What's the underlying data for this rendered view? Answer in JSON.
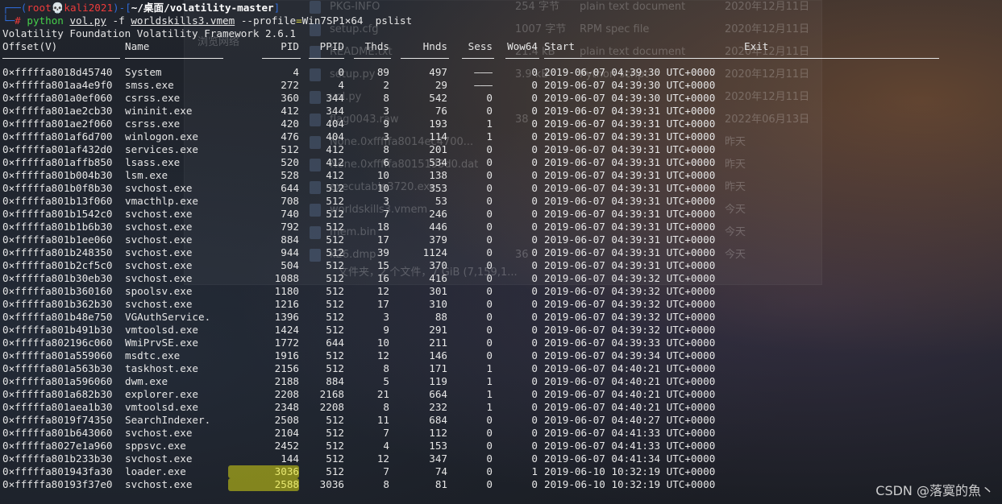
{
  "prompt": {
    "user": "root",
    "skull": "💀",
    "host": "kali2021",
    "path": "~/桌面/volatility-master",
    "hash": "#",
    "cmd_program": "python",
    "cmd_script": "vol.py",
    "cmd_flag_f": "-f",
    "cmd_image": "worldskills3.vmem",
    "cmd_profile_flag": "--profile",
    "cmd_profile_value": "Win7SP1×64",
    "cmd_plugin": "pslist"
  },
  "banner": "Volatility Foundation Volatility Framework 2.6.1",
  "table": {
    "headers": [
      "Offset(V)",
      "Name",
      "PID",
      "PPID",
      "Thds",
      "Hnds",
      "Sess",
      "Wow64",
      "Start",
      "Exit"
    ],
    "rows": [
      [
        "0×fffffa8018d45740",
        "System",
        "4",
        "0",
        "89",
        "497",
        "———",
        "0",
        "2019-06-07 04:39:30 UTC+0000"
      ],
      [
        "0×fffffa801aa4e9f0",
        "smss.exe",
        "272",
        "4",
        "2",
        "29",
        "———",
        "0",
        "2019-06-07 04:39:30 UTC+0000"
      ],
      [
        "0×fffffa801a0ef060",
        "csrss.exe",
        "360",
        "344",
        "8",
        "542",
        "0",
        "0",
        "2019-06-07 04:39:30 UTC+0000"
      ],
      [
        "0×fffffa801ae2cb30",
        "wininit.exe",
        "412",
        "344",
        "3",
        "76",
        "0",
        "0",
        "2019-06-07 04:39:31 UTC+0000"
      ],
      [
        "0×fffffa801ae2f060",
        "csrss.exe",
        "420",
        "404",
        "9",
        "193",
        "1",
        "0",
        "2019-06-07 04:39:31 UTC+0000"
      ],
      [
        "0×fffffa801af6d700",
        "winlogon.exe",
        "476",
        "404",
        "3",
        "114",
        "1",
        "0",
        "2019-06-07 04:39:31 UTC+0000"
      ],
      [
        "0×fffffa801af432d0",
        "services.exe",
        "512",
        "412",
        "8",
        "201",
        "0",
        "0",
        "2019-06-07 04:39:31 UTC+0000"
      ],
      [
        "0×fffffa801affb850",
        "lsass.exe",
        "520",
        "412",
        "6",
        "534",
        "0",
        "0",
        "2019-06-07 04:39:31 UTC+0000"
      ],
      [
        "0×fffffa801b004b30",
        "lsm.exe",
        "528",
        "412",
        "10",
        "138",
        "0",
        "0",
        "2019-06-07 04:39:31 UTC+0000"
      ],
      [
        "0×fffffa801b0f8b30",
        "svchost.exe",
        "644",
        "512",
        "10",
        "353",
        "0",
        "0",
        "2019-06-07 04:39:31 UTC+0000"
      ],
      [
        "0×fffffa801b13f060",
        "vmacthlp.exe",
        "708",
        "512",
        "3",
        "53",
        "0",
        "0",
        "2019-06-07 04:39:31 UTC+0000"
      ],
      [
        "0×fffffa801b1542c0",
        "svchost.exe",
        "740",
        "512",
        "7",
        "246",
        "0",
        "0",
        "2019-06-07 04:39:31 UTC+0000"
      ],
      [
        "0×fffffa801b1b6b30",
        "svchost.exe",
        "792",
        "512",
        "18",
        "446",
        "0",
        "0",
        "2019-06-07 04:39:31 UTC+0000"
      ],
      [
        "0×fffffa801b1ee060",
        "svchost.exe",
        "884",
        "512",
        "17",
        "379",
        "0",
        "0",
        "2019-06-07 04:39:31 UTC+0000"
      ],
      [
        "0×fffffa801b248350",
        "svchost.exe",
        "944",
        "512",
        "39",
        "1124",
        "0",
        "0",
        "2019-06-07 04:39:31 UTC+0000"
      ],
      [
        "0×fffffa801b2cf5c0",
        "svchost.exe",
        "504",
        "512",
        "15",
        "370",
        "0",
        "0",
        "2019-06-07 04:39:31 UTC+0000"
      ],
      [
        "0×fffffa801b30eb30",
        "svchost.exe",
        "1088",
        "512",
        "16",
        "416",
        "0",
        "0",
        "2019-06-07 04:39:32 UTC+0000"
      ],
      [
        "0×fffffa801b360160",
        "spoolsv.exe",
        "1180",
        "512",
        "12",
        "301",
        "0",
        "0",
        "2019-06-07 04:39:32 UTC+0000"
      ],
      [
        "0×fffffa801b362b30",
        "svchost.exe",
        "1216",
        "512",
        "17",
        "310",
        "0",
        "0",
        "2019-06-07 04:39:32 UTC+0000"
      ],
      [
        "0×fffffa801b48e750",
        "VGAuthService.",
        "1396",
        "512",
        "3",
        "88",
        "0",
        "0",
        "2019-06-07 04:39:32 UTC+0000"
      ],
      [
        "0×fffffa801b491b30",
        "vmtoolsd.exe",
        "1424",
        "512",
        "9",
        "291",
        "0",
        "0",
        "2019-06-07 04:39:32 UTC+0000"
      ],
      [
        "0×fffffa802196c060",
        "WmiPrvSE.exe",
        "1772",
        "644",
        "10",
        "211",
        "0",
        "0",
        "2019-06-07 04:39:33 UTC+0000"
      ],
      [
        "0×fffffa801a559060",
        "msdtc.exe",
        "1916",
        "512",
        "12",
        "146",
        "0",
        "0",
        "2019-06-07 04:39:34 UTC+0000"
      ],
      [
        "0×fffffa801a563b30",
        "taskhost.exe",
        "2156",
        "512",
        "8",
        "171",
        "1",
        "0",
        "2019-06-07 04:40:21 UTC+0000"
      ],
      [
        "0×fffffa801a596060",
        "dwm.exe",
        "2188",
        "884",
        "5",
        "119",
        "1",
        "0",
        "2019-06-07 04:40:21 UTC+0000"
      ],
      [
        "0×fffffa801a682b30",
        "explorer.exe",
        "2208",
        "2168",
        "21",
        "664",
        "1",
        "0",
        "2019-06-07 04:40:21 UTC+0000"
      ],
      [
        "0×fffffa801aea1b30",
        "vmtoolsd.exe",
        "2348",
        "2208",
        "8",
        "232",
        "1",
        "0",
        "2019-06-07 04:40:21 UTC+0000"
      ],
      [
        "0×fffffa8019f74350",
        "SearchIndexer.",
        "2508",
        "512",
        "11",
        "684",
        "0",
        "0",
        "2019-06-07 04:40:27 UTC+0000"
      ],
      [
        "0×fffffa801b643060",
        "svchost.exe",
        "2104",
        "512",
        "7",
        "112",
        "0",
        "0",
        "2019-06-07 04:41:33 UTC+0000"
      ],
      [
        "0×fffffa8027e1a960",
        "sppsvc.exe",
        "2452",
        "512",
        "4",
        "153",
        "0",
        "0",
        "2019-06-07 04:41:33 UTC+0000"
      ],
      [
        "0×fffffa801b233b30",
        "svchost.exe",
        "144",
        "512",
        "12",
        "347",
        "0",
        "0",
        "2019-06-07 04:41:34 UTC+0000"
      ],
      [
        "0×fffffa801943fa30",
        "loader.exe",
        "3036",
        "512",
        "7",
        "74",
        "0",
        "1",
        "2019-06-10 10:32:19 UTC+0000"
      ],
      [
        "0×fffffa80193f37e0",
        "svchost.exe",
        "2588",
        "3036",
        "8",
        "81",
        "0",
        "0",
        "2019-06-10 10:32:19 UTC+0000"
      ]
    ],
    "highlighted_pids": [
      "3036",
      "2588"
    ]
  },
  "background_file_manager": {
    "rows": [
      [
        "PKG-INFO",
        "254 字节",
        "plain text document",
        "2020年12月11日"
      ],
      [
        "setup.cfg",
        "1007 字节",
        "RPM spec file",
        "2020年12月11日"
      ],
      [
        "README.txt",
        "21.4 kB",
        "plain text document",
        "2020年12月11日"
      ],
      [
        "setup.py",
        "3.9 kB",
        "Python script",
        "2020年12月11日"
      ],
      [
        "vol.py",
        "",
        "",
        "2020年12月11日"
      ],
      [
        "flag0043.raw",
        "38",
        "",
        "2022年06月13日"
      ],
      [
        "None.0xfffffa8014ec4700...",
        "",
        "",
        "昨天"
      ],
      [
        "None.0xfffffa8015193d0.dat",
        "",
        "",
        "昨天"
      ],
      [
        "executable3720.exe",
        "",
        "",
        "昨天"
      ],
      [
        "worldskills3.vmem",
        "",
        "",
        "今天"
      ],
      [
        "mem.bin",
        "",
        "",
        "今天"
      ],
      [
        "k26.dmp",
        "36",
        "",
        "今天"
      ]
    ],
    "status": "文件夹，2 个文件，7 GiB (7,159,1..."
  },
  "sidebar_ghost": "浏览网络",
  "watermark": "CSDN @落寞的魚丶"
}
